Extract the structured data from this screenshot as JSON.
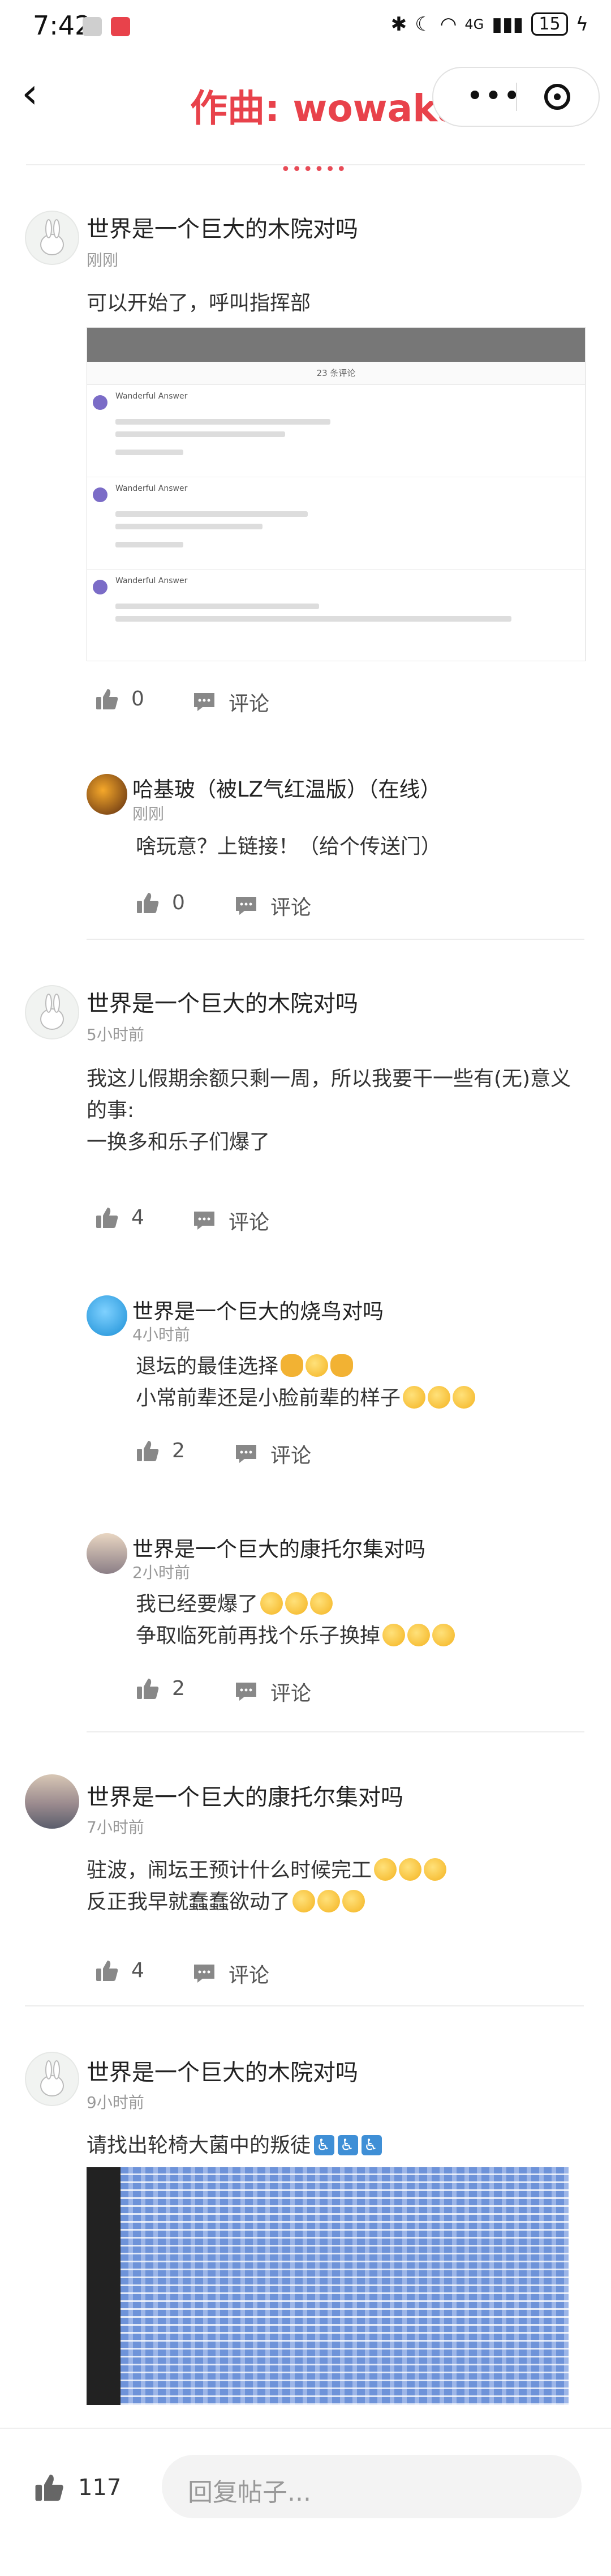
{
  "status_bar": {
    "time": "7:42",
    "network": "4G",
    "battery": "15"
  },
  "nav": {
    "title": "作曲: wowaka"
  },
  "thread": [
    {
      "user": "世界是一个巨大的木院对吗",
      "time": "刚刚",
      "text": "可以开始了，呼叫指挥部",
      "likes": "0",
      "comment_label": "评论",
      "embedded_screenshot": {
        "header": "23 条评论",
        "items": [
          {
            "name": "Wanderful Answer"
          },
          {
            "name": "Wanderful Answer"
          },
          {
            "name": "Wanderful Answer"
          }
        ]
      },
      "replies": [
        {
          "user": "哈基玻（被LZ气红温版）（在线）",
          "time": "刚刚",
          "text": "啥玩意？上链接！（给个传送门）",
          "likes": "0",
          "comment_label": "评论"
        }
      ]
    },
    {
      "user": "世界是一个巨大的木院对吗",
      "time": "5小时前",
      "text_lines": [
        "我这儿假期余额只剩一周，所以我要干一些有(无)意义",
        "的事:",
        "一换多和乐子们爆了"
      ],
      "likes": "4",
      "comment_label": "评论",
      "replies": [
        {
          "user": "世界是一个巨大的烧鸟对吗",
          "time": "4小时前",
          "text_lines": [
            "退坛的最佳选择",
            "小常前辈还是小脸前辈的样子"
          ],
          "likes": "2",
          "comment_label": "评论"
        },
        {
          "user": "世界是一个巨大的康托尔集对吗",
          "time": "2小时前",
          "text_lines": [
            "我已经要爆了",
            "争取临死前再找个乐子换掉"
          ],
          "likes": "2",
          "comment_label": "评论"
        }
      ]
    },
    {
      "user": "世界是一个巨大的康托尔集对吗",
      "time": "7小时前",
      "text_lines": [
        "驻波，闹坛王预计什么时候完工",
        "反正我早就蠢蠢欲动了"
      ],
      "likes": "4",
      "comment_label": "评论"
    },
    {
      "user": "世界是一个巨大的木院对吗",
      "time": "9小时前",
      "text": "请找出轮椅大菌中的叛徒"
    }
  ],
  "bottom": {
    "likes": "117",
    "reply_placeholder": "回复帖子..."
  }
}
